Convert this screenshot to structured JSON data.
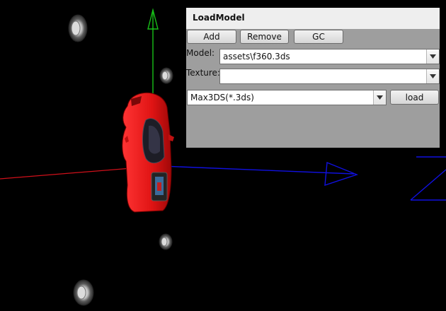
{
  "panel": {
    "title": "LoadModel",
    "buttons": {
      "add": "Add",
      "remove": "Remove",
      "gc": "GC",
      "load": "load"
    },
    "model_label": "Model:",
    "model_value": "assets\\f360.3ds",
    "texture_label": "Texture:",
    "texture_value": "",
    "format_value": "Max3DS(*.3ds)"
  },
  "colors": {
    "x_axis": "#d0101a",
    "y_axis": "#18c018",
    "z_axis": "#1010e0",
    "car_body": "#e01414"
  },
  "icons": [
    "wheel-icon",
    "chevron-down-icon"
  ]
}
